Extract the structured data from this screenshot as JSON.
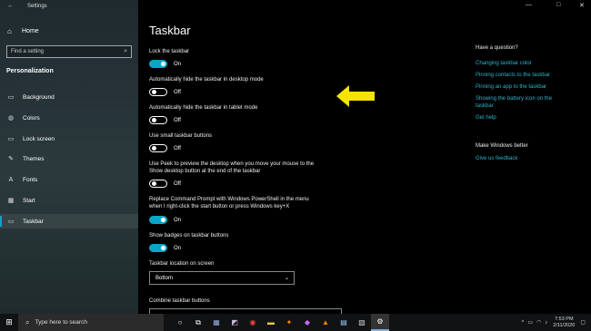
{
  "window": {
    "title": "Settings"
  },
  "sidebar": {
    "home": "Home",
    "search_placeholder": "Find a setting",
    "section": "Personalization",
    "items": [
      {
        "label": "Background"
      },
      {
        "label": "Colors"
      },
      {
        "label": "Lock screen"
      },
      {
        "label": "Themes"
      },
      {
        "label": "Fonts"
      },
      {
        "label": "Start"
      },
      {
        "label": "Taskbar"
      }
    ]
  },
  "main": {
    "title": "Taskbar",
    "settings": [
      {
        "label": "Lock the taskbar",
        "state": "On"
      },
      {
        "label": "Automatically hide the taskbar in desktop mode",
        "state": "Off"
      },
      {
        "label": "Automatically hide the taskbar in tablet mode",
        "state": "Off"
      },
      {
        "label": "Use small taskbar buttons",
        "state": "Off"
      },
      {
        "label_line1": "Use Peek to preview the desktop when you move your mouse to the",
        "label_line2": "Show desktop button at the end of the taskbar",
        "state": "Off"
      },
      {
        "label_line1": "Replace Command Prompt with Windows PowerShell in the menu",
        "label_line2": "when I right-click the start button or press Windows key+X",
        "state": "On"
      },
      {
        "label": "Show badges on taskbar buttons",
        "state": "On"
      }
    ],
    "location_label": "Taskbar location on screen",
    "location_value": "Bottom",
    "combine_label": "Combine taskbar buttons"
  },
  "help": {
    "heading": "Have a question?",
    "links": [
      "Changing taskbar color",
      "Pinning contacts to the taskbar",
      "Pinning an app to the taskbar"
    ],
    "battery_line1": "Showing the battery icon on the",
    "battery_line2": "taskbar",
    "get_help": "Get help",
    "better_heading": "Make Windows better",
    "feedback": "Give us feedback"
  },
  "taskbar": {
    "search_placeholder": "Type here to search",
    "time": "7:53 PM",
    "date": "2/11/2020"
  },
  "colors": {
    "accent": "#0aa5c8",
    "link": "#2eb3c9",
    "arrow": "#f5e400"
  }
}
